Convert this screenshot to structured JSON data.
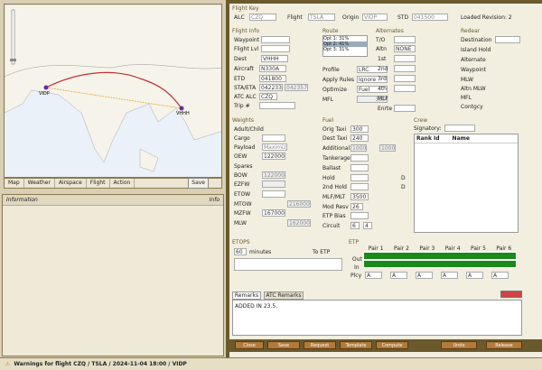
{
  "map": {
    "nav_labels": [
      "Map",
      "Weather",
      "Airspace",
      "Flight",
      "Action"
    ],
    "save_label": "Save",
    "origin_code": "VIDP",
    "dest_code": "VHHH"
  },
  "info": {
    "title": "Information",
    "info_btn": "Info"
  },
  "flightkey": {
    "title": "Flight Key",
    "alc_label": "ALC",
    "alc": "CZQ",
    "flight_label": "Flight",
    "flight": "TSLA",
    "origin_label": "Origin",
    "origin": "VIDP",
    "std_label": "STD",
    "std": "041500",
    "loaded": "Loaded Revision: 2"
  },
  "flightinfo": {
    "title": "Flight Info",
    "waypoint": "Waypoint",
    "flightlvl": "Flight Lvl",
    "dest_label": "Dest",
    "dest": "VHHH",
    "aircraft_label": "Aircraft",
    "aircraft": "N330A",
    "etd_label": "ETD",
    "etd": "041800",
    "sta_label": "STA/ETA",
    "sta": "042233",
    "eta": "042357",
    "atc_label": "ATC ALC",
    "atc": "CZQ",
    "trip_label": "Trip #"
  },
  "route": {
    "title": "Route",
    "options": [
      "Opt 1: 31%",
      "Opt 2: 41%",
      "Opt 3: 31%"
    ],
    "profile_label": "Profile",
    "profile": "LRC",
    "rules_label": "Apply Rules",
    "rules": "Ignore",
    "optimize_label": "Optimize",
    "optimize": "Fuel",
    "mfl_label": "MFL",
    "mfl": "300"
  },
  "alternates": {
    "title": "Alternates",
    "to_label": "T/O",
    "altn_label": "Altn",
    "altn": "NONE",
    "r1": "1st",
    "r2": "2nd",
    "r3": "3rd",
    "r4": "4th",
    "mlf_label": "MLF",
    "enrte_label": "Enrte"
  },
  "redear": {
    "title": "Redear",
    "destination": "Destination",
    "island": "Island Hold",
    "alternate": "Alternate",
    "waypoint": "Waypoint",
    "mlw": "MLW",
    "altnmlw": "Altn MLW",
    "mfl": "MFL",
    "contgcy": "Contgcy"
  },
  "weights": {
    "title": "Weights",
    "adult": "Adult/Child",
    "cargo": "Cargo",
    "payload_label": "Payload",
    "payload": "Maximize",
    "oew_label": "OEW",
    "oew": "122000",
    "spares": "Spares",
    "bow_label": "BOW",
    "bow": "122000",
    "ezfw": "EZFW",
    "etow": "ETOW",
    "mtow_label": "MTOW",
    "mtow": "216000",
    "mzfw_label": "MZFW",
    "mzfw": "167000",
    "mlw_label": "MLW",
    "mlw": "162000"
  },
  "fuel": {
    "title": "Fuel",
    "orig_label": "Orig Taxi",
    "orig": "300",
    "dest_label": "Dest Taxi",
    "dest": "240",
    "add_label": "Additional",
    "add1": "1000",
    "add2": "1000",
    "tank": "Tankerage",
    "ballast": "Ballast",
    "hold": "Hold",
    "hold2": "2nd Hold",
    "mlfmlt_label": "MLF/MLT",
    "mlfmlt": "3500",
    "mod_label": "Mod Resv",
    "mod": "26",
    "etp_label": "ETP Bias",
    "circuit_label": "Circuit",
    "c1": "6",
    "c2": "4",
    "d": "D"
  },
  "crew": {
    "title": "Crew",
    "signatory": "Signatory:",
    "rank": "Rank Id",
    "name": "Name"
  },
  "etops": {
    "title": "ETOPS",
    "minutes_val": "60",
    "minutes_label": "minutes",
    "toetp": "To ETP"
  },
  "etp": {
    "title": "ETP",
    "pairs": [
      "Pair 1",
      "Pair 2",
      "Pair 3",
      "Pair 4",
      "Pair 5",
      "Pair 6"
    ],
    "rows": [
      "Out",
      "In",
      "Plcy"
    ],
    "plcy": "A"
  },
  "remarks": {
    "tab1": "Remarks",
    "tab2": "ATC Remarks",
    "text": "ADDED IN 23.5."
  },
  "buttons": {
    "close": "Close",
    "save": "Save",
    "request": "Request",
    "template": "Template",
    "compute": "Compute",
    "undo": "Undo",
    "release": "Release"
  },
  "status": {
    "text": "Warnings for flight CZQ / TSLA / 2024-11-04 18:00 / VIDP"
  },
  "colors": {
    "chrome": "#6b5a2e",
    "panel": "#f2eee0",
    "etp_grid": "#1a8a1a",
    "route_line": "#c0303a"
  }
}
